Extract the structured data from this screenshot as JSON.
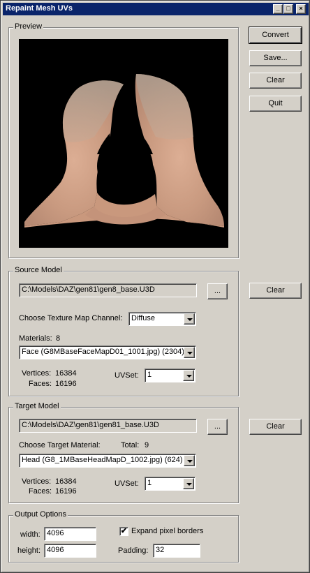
{
  "window": {
    "title": "Repaint Mesh UVs"
  },
  "preview_group": {
    "label": "Preview"
  },
  "actions": {
    "convert": "Convert",
    "save": "Save...",
    "clear": "Clear",
    "quit": "Quit"
  },
  "source": {
    "label": "Source Model",
    "path": "C:\\Models\\DAZ\\gen81\\gen8_base.U3D",
    "browse": "...",
    "clear": "Clear",
    "channel_label": "Choose Texture Map Channel:",
    "channel_value": "Diffuse",
    "materials_label": "Materials:",
    "materials_count": "8",
    "material_value": "Face (G8MBaseFaceMapD01_1001.jpg) (2304)",
    "vertices_label": "Vertices:",
    "vertices": "16384",
    "faces_label": "Faces:",
    "faces": "16196",
    "uvset_label": "UVSet:",
    "uvset_value": "1"
  },
  "target": {
    "label": "Target Model",
    "path": "C:\\Models\\DAZ\\gen81\\gen81_base.U3D",
    "browse": "...",
    "clear": "Clear",
    "material_label": "Choose Target Material:",
    "total_label": "Total:",
    "total": "9",
    "material_value": "Head (G8_1MBaseHeadMapD_1002.jpg) (624)",
    "vertices_label": "Vertices:",
    "vertices": "16384",
    "faces_label": "Faces:",
    "faces": "16196",
    "uvset_label": "UVSet:",
    "uvset_value": "1"
  },
  "output": {
    "label": "Output Options",
    "width_label": "width:",
    "width": "4096",
    "height_label": "height:",
    "height": "4096",
    "expand_label": "Expand pixel borders",
    "expand_checked": "✔",
    "padding_label": "Padding:",
    "padding": "32"
  }
}
